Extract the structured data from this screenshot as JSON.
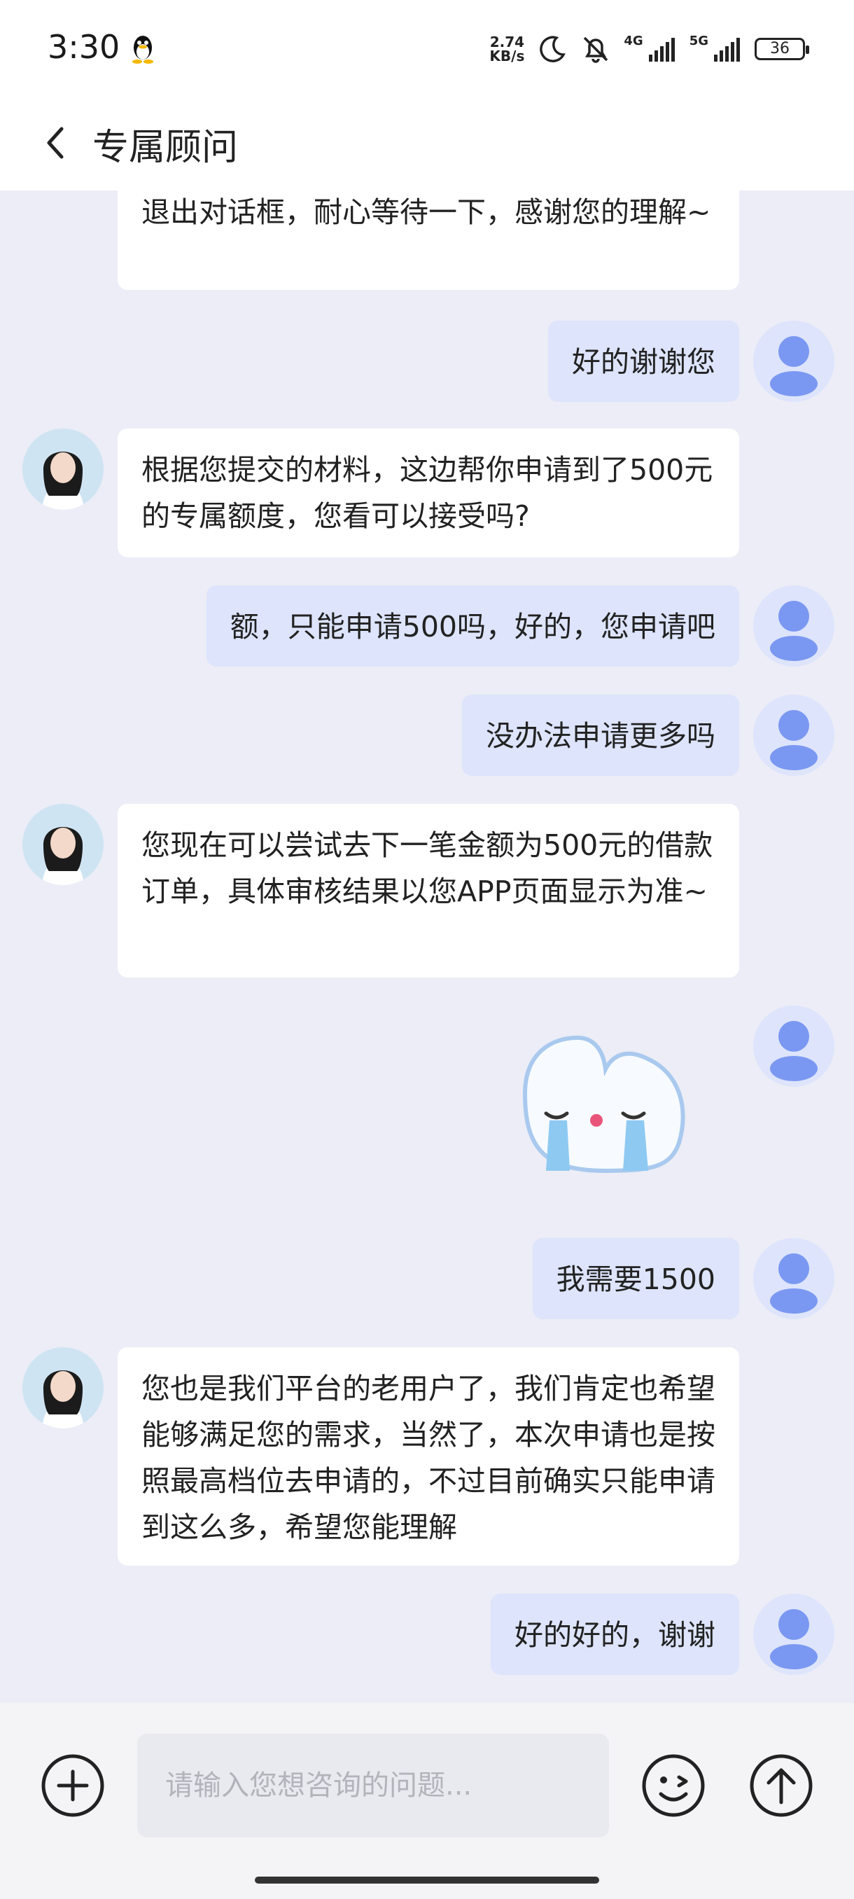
{
  "status_bar": {
    "time": "3:30",
    "net_speed_value": "2.74",
    "net_speed_unit": "KB/s",
    "signal1_label": "4G",
    "signal2_label": "5G",
    "battery": "36"
  },
  "header": {
    "title": "专属顾问"
  },
  "messages": [
    {
      "from": "agent",
      "text": "退出对话框，耐心等待一下，感谢您的理解~"
    },
    {
      "from": "user",
      "text": "好的谢谢您"
    },
    {
      "from": "agent",
      "text": "根据您提交的材料，这边帮你申请到了500元的专属额度，您看可以接受吗?"
    },
    {
      "from": "user",
      "text": "额，只能申请500吗，好的，您申请吧"
    },
    {
      "from": "user",
      "text": "没办法申请更多吗"
    },
    {
      "from": "agent",
      "text": "您现在可以尝试去下一笔金额为500元的借款订单，具体审核结果以您APP页面显示为准~"
    },
    {
      "from": "user",
      "type": "sticker",
      "icon": "crying-heart-sticker"
    },
    {
      "from": "user",
      "text": "我需要1500"
    },
    {
      "from": "agent",
      "text": "您也是我们平台的老用户了，我们肯定也希望能够满足您的需求，当然了，本次申请也是按照最高档位去申请的，不过目前确实只能申请到这么多，希望您能理解"
    },
    {
      "from": "user",
      "text": "好的好的，谢谢"
    }
  ],
  "input": {
    "placeholder": "请输入您想咨询的问题..."
  },
  "colors": {
    "background": "#ecedf6",
    "user_bubble": "#dde4fc",
    "agent_bubble": "#ffffff",
    "user_avatar": "#7a98f2"
  }
}
